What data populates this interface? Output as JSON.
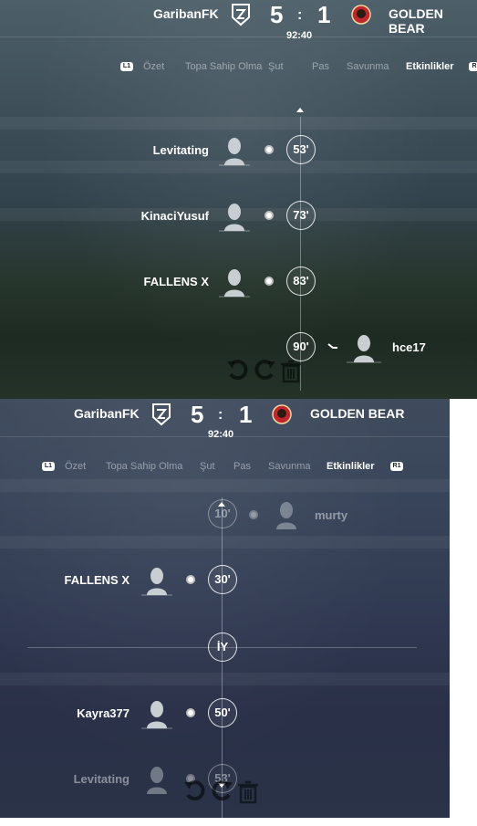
{
  "colors": {
    "accent": "#ffffff",
    "inactive_tab": "#8a96a3",
    "timeline": "#9aa6b0"
  },
  "top": {
    "header": {
      "home_team": "GaribanFK",
      "home_score": "5",
      "separator": ":",
      "away_score": "1",
      "away_team": "GOLDEN BEAR",
      "clock": "92:40"
    },
    "tabs": {
      "left_bumper": "L1",
      "right_bumper": "R",
      "items": [
        "Özet",
        "Topa Sahip Olma",
        "Şut",
        "Pas",
        "Savunma",
        "Etkinlikler"
      ],
      "active": "Etkinlikler"
    },
    "events": [
      {
        "player": "Levitating",
        "minute": "53'",
        "side": "home",
        "icon": "goal-ball-icon"
      },
      {
        "player": "KinaciYusuf",
        "minute": "73'",
        "side": "home",
        "icon": "goal-ball-icon"
      },
      {
        "player": "FALLENS X",
        "minute": "83'",
        "side": "home",
        "icon": "goal-ball-icon"
      },
      {
        "player": "hce17",
        "minute": "90'",
        "side": "away",
        "icon": "substitution-icon"
      }
    ]
  },
  "bottom": {
    "header": {
      "home_team": "GaribanFK",
      "home_score": "5",
      "separator": ":",
      "away_score": "1",
      "away_team": "GOLDEN BEAR",
      "clock": "92:40"
    },
    "tabs": {
      "left_bumper": "L1",
      "right_bumper": "R1",
      "items": [
        "Özet",
        "Topa Sahip Olma",
        "Şut",
        "Pas",
        "Savunma",
        "Etkinlikler"
      ],
      "active": "Etkinlikler"
    },
    "events": [
      {
        "player": "murty",
        "minute": "10'",
        "side": "away",
        "icon": "goal-ball-icon"
      },
      {
        "player": "FALLENS X",
        "minute": "30'",
        "side": "home",
        "icon": "goal-ball-icon"
      },
      {
        "player": "Kayra377",
        "minute": "50'",
        "side": "home",
        "icon": "goal-ball-icon"
      },
      {
        "player": "Levitating",
        "minute": "53'",
        "side": "home",
        "icon": "goal-ball-icon"
      }
    ],
    "halftime_label": "İY"
  }
}
